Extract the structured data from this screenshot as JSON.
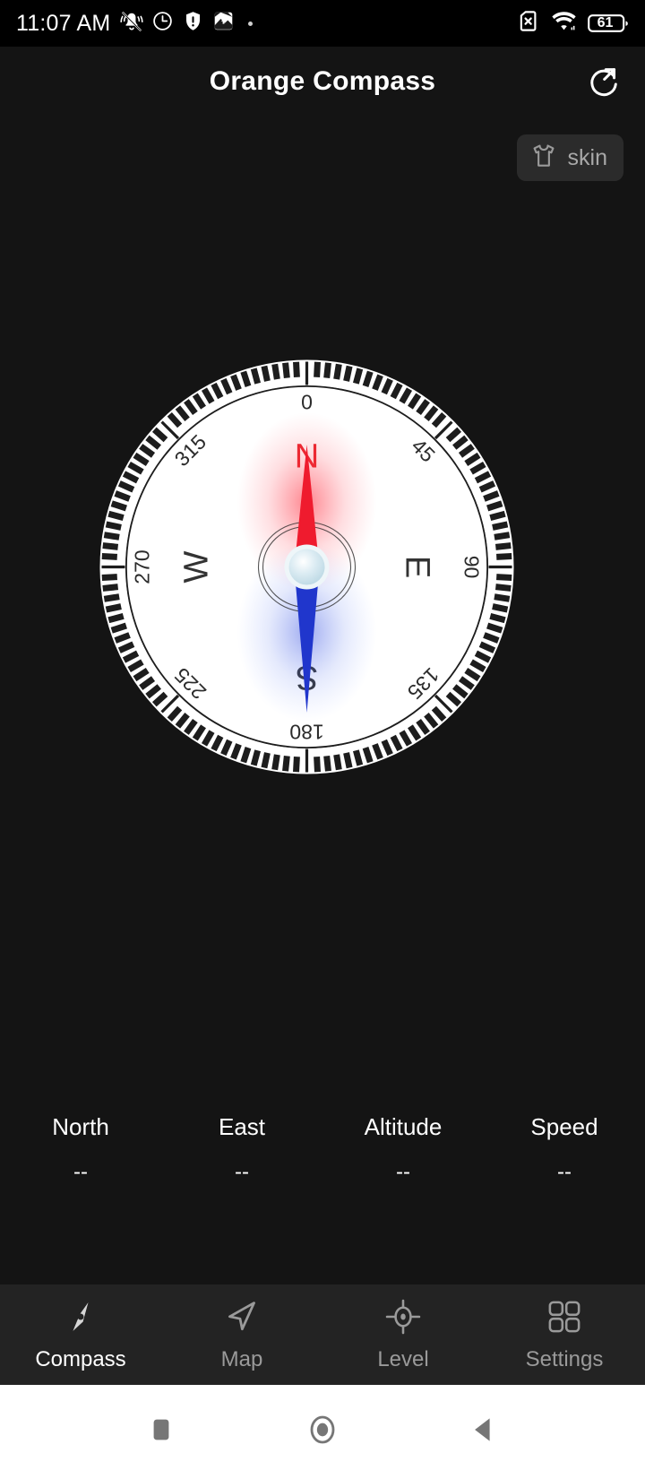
{
  "status_bar": {
    "time": "11:07 AM",
    "left_icons": [
      "vibrate-off-icon",
      "alarm-clock-icon",
      "security-shield-icon",
      "app-notification-icon",
      "more-dot-icon"
    ],
    "right_icons": [
      "no-sim-icon",
      "wifi-icon",
      "battery-icon"
    ],
    "battery_level": "61"
  },
  "header": {
    "title": "Orange Compass",
    "share_icon": "share-rotate-icon"
  },
  "skin_button": {
    "label": "skin",
    "icon": "tshirt-icon"
  },
  "compass": {
    "cardinals": [
      {
        "label": "N",
        "angle": 0,
        "color": "#e8222a"
      },
      {
        "label": "E",
        "angle": 90,
        "color": "#333333"
      },
      {
        "label": "S",
        "angle": 180,
        "color": "#333333"
      },
      {
        "label": "W",
        "angle": 270,
        "color": "#333333"
      }
    ],
    "degree_labels": [
      "0",
      "45",
      "90",
      "135",
      "180",
      "225",
      "270",
      "315"
    ],
    "heading_degrees": 0,
    "needle_north_color": "#ef1b2e",
    "needle_south_color": "#2036cc",
    "dial_color": "#ffffff",
    "tick_color": "#1d1d1d"
  },
  "readouts": [
    {
      "label": "North",
      "value": "--"
    },
    {
      "label": "East",
      "value": "--"
    },
    {
      "label": "Altitude",
      "value": "--"
    },
    {
      "label": "Speed",
      "value": "--"
    }
  ],
  "bottom_nav": {
    "items": [
      {
        "label": "Compass",
        "icon": "compass-needle-icon",
        "active": true
      },
      {
        "label": "Map",
        "icon": "navigation-arrow-icon",
        "active": false
      },
      {
        "label": "Level",
        "icon": "crosshair-level-icon",
        "active": false
      },
      {
        "label": "Settings",
        "icon": "grid-squares-icon",
        "active": false
      }
    ]
  },
  "system_nav": {
    "buttons": [
      "recents-square-icon",
      "home-circle-icon",
      "back-triangle-icon"
    ]
  }
}
